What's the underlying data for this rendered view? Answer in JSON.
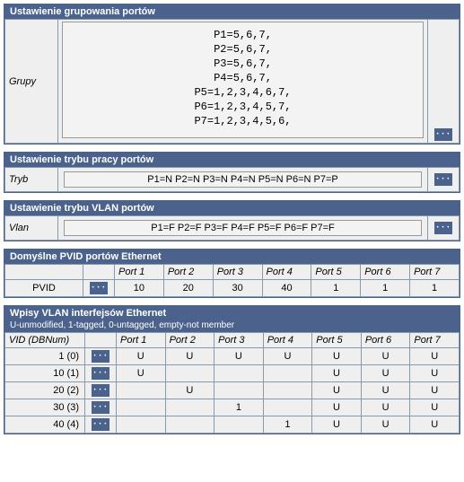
{
  "grouping": {
    "header": "Ustawienie grupowania portów",
    "label": "Grupy",
    "value": "P1=5,6,7,\nP2=5,6,7,\nP3=5,6,7,\nP4=5,6,7,\nP5=1,2,3,4,6,7,\nP6=1,2,3,4,5,7,\nP7=1,2,3,4,5,6,"
  },
  "mode": {
    "header": "Ustawienie trybu pracy portów",
    "label": "Tryb",
    "value": "P1=N P2=N P3=N P4=N P5=N P6=N P7=P"
  },
  "vlanmode": {
    "header": "Ustawienie trybu VLAN portów",
    "label": "Vlan",
    "value": "P1=F P2=F P3=F P4=F P5=F P6=F P7=F"
  },
  "pvid": {
    "header": "Domyślne PVID portów Ethernet",
    "row_label": "PVID",
    "ports": [
      "Port 1",
      "Port 2",
      "Port 3",
      "Port 4",
      "Port 5",
      "Port 6",
      "Port 7"
    ],
    "values": [
      "10",
      "20",
      "30",
      "40",
      "1",
      "1",
      "1"
    ]
  },
  "vlan": {
    "header": "Wpisy VLAN interfejsów Ethernet",
    "sub": "U-unmodified, 1-tagged, 0-untagged, empty-not member",
    "vid_header": "VID (DBNum)",
    "ports": [
      "Port 1",
      "Port 2",
      "Port 3",
      "Port 4",
      "Port 5",
      "Port 6",
      "Port 7"
    ],
    "rows": [
      {
        "vid": "1 (0)",
        "cells": [
          "U",
          "U",
          "U",
          "U",
          "U",
          "U",
          "U"
        ]
      },
      {
        "vid": "10 (1)",
        "cells": [
          "U",
          "",
          "",
          "",
          "U",
          "U",
          "U"
        ]
      },
      {
        "vid": "20 (2)",
        "cells": [
          "",
          "U",
          "",
          "",
          "U",
          "U",
          "U"
        ]
      },
      {
        "vid": "30 (3)",
        "cells": [
          "",
          "",
          "1",
          "",
          "U",
          "U",
          "U"
        ]
      },
      {
        "vid": "40 (4)",
        "cells": [
          "",
          "",
          "",
          "1",
          "U",
          "U",
          "U"
        ]
      }
    ]
  },
  "btn_glyph": "• • •"
}
